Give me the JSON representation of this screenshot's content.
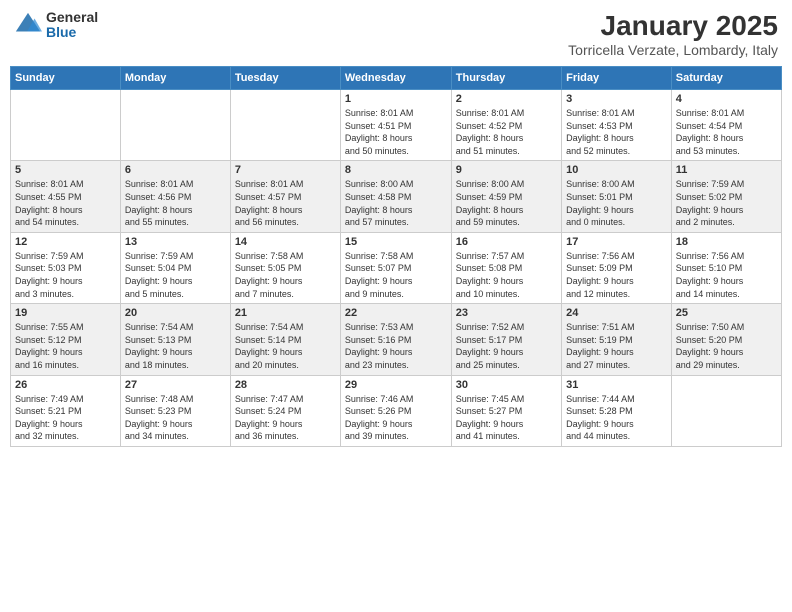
{
  "logo": {
    "general": "General",
    "blue": "Blue"
  },
  "header": {
    "month": "January 2025",
    "location": "Torricella Verzate, Lombardy, Italy"
  },
  "weekdays": [
    "Sunday",
    "Monday",
    "Tuesday",
    "Wednesday",
    "Thursday",
    "Friday",
    "Saturday"
  ],
  "weeks": [
    [
      {
        "day": "",
        "info": ""
      },
      {
        "day": "",
        "info": ""
      },
      {
        "day": "",
        "info": ""
      },
      {
        "day": "1",
        "info": "Sunrise: 8:01 AM\nSunset: 4:51 PM\nDaylight: 8 hours\nand 50 minutes."
      },
      {
        "day": "2",
        "info": "Sunrise: 8:01 AM\nSunset: 4:52 PM\nDaylight: 8 hours\nand 51 minutes."
      },
      {
        "day": "3",
        "info": "Sunrise: 8:01 AM\nSunset: 4:53 PM\nDaylight: 8 hours\nand 52 minutes."
      },
      {
        "day": "4",
        "info": "Sunrise: 8:01 AM\nSunset: 4:54 PM\nDaylight: 8 hours\nand 53 minutes."
      }
    ],
    [
      {
        "day": "5",
        "info": "Sunrise: 8:01 AM\nSunset: 4:55 PM\nDaylight: 8 hours\nand 54 minutes."
      },
      {
        "day": "6",
        "info": "Sunrise: 8:01 AM\nSunset: 4:56 PM\nDaylight: 8 hours\nand 55 minutes."
      },
      {
        "day": "7",
        "info": "Sunrise: 8:01 AM\nSunset: 4:57 PM\nDaylight: 8 hours\nand 56 minutes."
      },
      {
        "day": "8",
        "info": "Sunrise: 8:00 AM\nSunset: 4:58 PM\nDaylight: 8 hours\nand 57 minutes."
      },
      {
        "day": "9",
        "info": "Sunrise: 8:00 AM\nSunset: 4:59 PM\nDaylight: 8 hours\nand 59 minutes."
      },
      {
        "day": "10",
        "info": "Sunrise: 8:00 AM\nSunset: 5:01 PM\nDaylight: 9 hours\nand 0 minutes."
      },
      {
        "day": "11",
        "info": "Sunrise: 7:59 AM\nSunset: 5:02 PM\nDaylight: 9 hours\nand 2 minutes."
      }
    ],
    [
      {
        "day": "12",
        "info": "Sunrise: 7:59 AM\nSunset: 5:03 PM\nDaylight: 9 hours\nand 3 minutes."
      },
      {
        "day": "13",
        "info": "Sunrise: 7:59 AM\nSunset: 5:04 PM\nDaylight: 9 hours\nand 5 minutes."
      },
      {
        "day": "14",
        "info": "Sunrise: 7:58 AM\nSunset: 5:05 PM\nDaylight: 9 hours\nand 7 minutes."
      },
      {
        "day": "15",
        "info": "Sunrise: 7:58 AM\nSunset: 5:07 PM\nDaylight: 9 hours\nand 9 minutes."
      },
      {
        "day": "16",
        "info": "Sunrise: 7:57 AM\nSunset: 5:08 PM\nDaylight: 9 hours\nand 10 minutes."
      },
      {
        "day": "17",
        "info": "Sunrise: 7:56 AM\nSunset: 5:09 PM\nDaylight: 9 hours\nand 12 minutes."
      },
      {
        "day": "18",
        "info": "Sunrise: 7:56 AM\nSunset: 5:10 PM\nDaylight: 9 hours\nand 14 minutes."
      }
    ],
    [
      {
        "day": "19",
        "info": "Sunrise: 7:55 AM\nSunset: 5:12 PM\nDaylight: 9 hours\nand 16 minutes."
      },
      {
        "day": "20",
        "info": "Sunrise: 7:54 AM\nSunset: 5:13 PM\nDaylight: 9 hours\nand 18 minutes."
      },
      {
        "day": "21",
        "info": "Sunrise: 7:54 AM\nSunset: 5:14 PM\nDaylight: 9 hours\nand 20 minutes."
      },
      {
        "day": "22",
        "info": "Sunrise: 7:53 AM\nSunset: 5:16 PM\nDaylight: 9 hours\nand 23 minutes."
      },
      {
        "day": "23",
        "info": "Sunrise: 7:52 AM\nSunset: 5:17 PM\nDaylight: 9 hours\nand 25 minutes."
      },
      {
        "day": "24",
        "info": "Sunrise: 7:51 AM\nSunset: 5:19 PM\nDaylight: 9 hours\nand 27 minutes."
      },
      {
        "day": "25",
        "info": "Sunrise: 7:50 AM\nSunset: 5:20 PM\nDaylight: 9 hours\nand 29 minutes."
      }
    ],
    [
      {
        "day": "26",
        "info": "Sunrise: 7:49 AM\nSunset: 5:21 PM\nDaylight: 9 hours\nand 32 minutes."
      },
      {
        "day": "27",
        "info": "Sunrise: 7:48 AM\nSunset: 5:23 PM\nDaylight: 9 hours\nand 34 minutes."
      },
      {
        "day": "28",
        "info": "Sunrise: 7:47 AM\nSunset: 5:24 PM\nDaylight: 9 hours\nand 36 minutes."
      },
      {
        "day": "29",
        "info": "Sunrise: 7:46 AM\nSunset: 5:26 PM\nDaylight: 9 hours\nand 39 minutes."
      },
      {
        "day": "30",
        "info": "Sunrise: 7:45 AM\nSunset: 5:27 PM\nDaylight: 9 hours\nand 41 minutes."
      },
      {
        "day": "31",
        "info": "Sunrise: 7:44 AM\nSunset: 5:28 PM\nDaylight: 9 hours\nand 44 minutes."
      },
      {
        "day": "",
        "info": ""
      }
    ]
  ]
}
